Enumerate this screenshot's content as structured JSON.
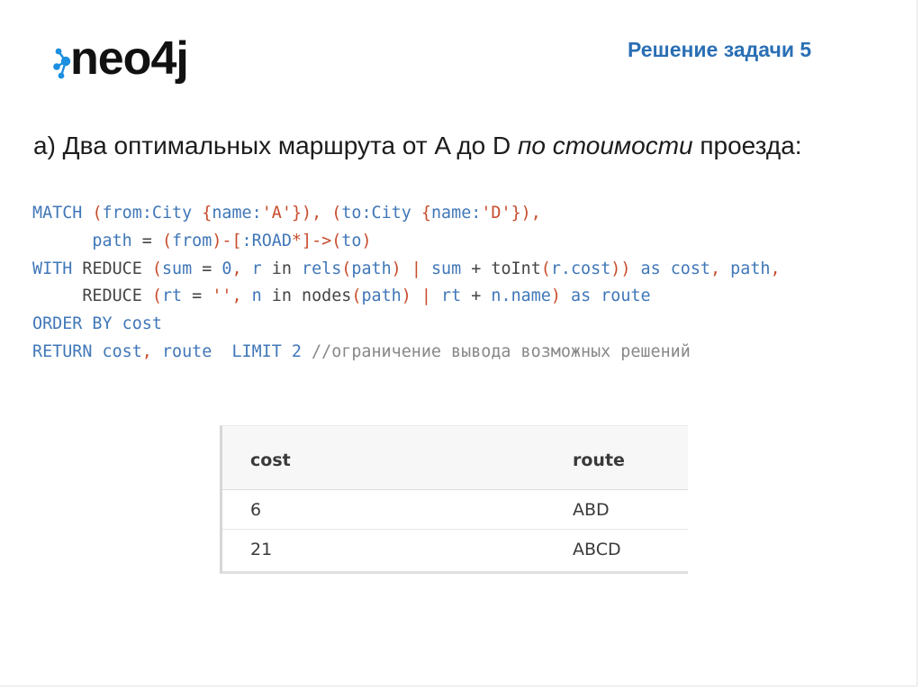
{
  "header": {
    "logo_text": "neo4j",
    "title": "Решение задачи 5"
  },
  "subtitle": {
    "prefix": "а) Два оптимальных маршрута от A до D ",
    "emphasis": "по стоимости",
    "suffix": " проезда:"
  },
  "code": {
    "lines": [
      [
        {
          "t": "MATCH",
          "c": "kw"
        },
        {
          "t": " (",
          "c": "pn"
        },
        {
          "t": "from:City",
          "c": "kw"
        },
        {
          "t": " {",
          "c": "pn"
        },
        {
          "t": "name:",
          "c": "kw"
        },
        {
          "t": "'A'",
          "c": "pn"
        },
        {
          "t": "}), (",
          "c": "pn"
        },
        {
          "t": "to:City",
          "c": "kw"
        },
        {
          "t": " {",
          "c": "pn"
        },
        {
          "t": "name:",
          "c": "kw"
        },
        {
          "t": "'D'",
          "c": "pn"
        },
        {
          "t": "}),",
          "c": "pn"
        }
      ],
      [
        {
          "t": "      path",
          "c": "kw"
        },
        {
          "t": " = ",
          "c": "df"
        },
        {
          "t": "(",
          "c": "pn"
        },
        {
          "t": "from",
          "c": "kw"
        },
        {
          "t": ")-[",
          "c": "pn"
        },
        {
          "t": ":ROAD",
          "c": "kw"
        },
        {
          "t": "*]->(",
          "c": "pn"
        },
        {
          "t": "to",
          "c": "kw"
        },
        {
          "t": ")",
          "c": "pn"
        }
      ],
      [
        {
          "t": "WITH",
          "c": "kw"
        },
        {
          "t": " REDUCE ",
          "c": "df"
        },
        {
          "t": "(",
          "c": "pn"
        },
        {
          "t": "sum",
          "c": "kw"
        },
        {
          "t": " = ",
          "c": "df"
        },
        {
          "t": "0",
          "c": "kw"
        },
        {
          "t": ", ",
          "c": "pn"
        },
        {
          "t": "r",
          "c": "kw"
        },
        {
          "t": " in ",
          "c": "df"
        },
        {
          "t": "rels",
          "c": "kw"
        },
        {
          "t": "(",
          "c": "pn"
        },
        {
          "t": "path",
          "c": "kw"
        },
        {
          "t": ") | ",
          "c": "pn"
        },
        {
          "t": "sum",
          "c": "kw"
        },
        {
          "t": " + toInt",
          "c": "df"
        },
        {
          "t": "(",
          "c": "pn"
        },
        {
          "t": "r.cost",
          "c": "kw"
        },
        {
          "t": ")) ",
          "c": "pn"
        },
        {
          "t": "as cost",
          "c": "kw"
        },
        {
          "t": ", ",
          "c": "pn"
        },
        {
          "t": "path",
          "c": "kw"
        },
        {
          "t": ",",
          "c": "pn"
        }
      ],
      [
        {
          "t": "     REDUCE ",
          "c": "df"
        },
        {
          "t": "(",
          "c": "pn"
        },
        {
          "t": "rt",
          "c": "kw"
        },
        {
          "t": " = ",
          "c": "df"
        },
        {
          "t": "''",
          "c": "pn"
        },
        {
          "t": ", ",
          "c": "pn"
        },
        {
          "t": "n",
          "c": "kw"
        },
        {
          "t": " in nodes",
          "c": "df"
        },
        {
          "t": "(",
          "c": "pn"
        },
        {
          "t": "path",
          "c": "kw"
        },
        {
          "t": ") | ",
          "c": "pn"
        },
        {
          "t": "rt",
          "c": "kw"
        },
        {
          "t": " + ",
          "c": "df"
        },
        {
          "t": "n.name",
          "c": "kw"
        },
        {
          "t": ") ",
          "c": "pn"
        },
        {
          "t": "as route",
          "c": "kw"
        }
      ],
      [
        {
          "t": "ORDER BY cost",
          "c": "kw"
        }
      ],
      [
        {
          "t": "RETURN cost",
          "c": "kw"
        },
        {
          "t": ", ",
          "c": "pn"
        },
        {
          "t": "route  LIMIT 2 ",
          "c": "kw"
        },
        {
          "t": "//ограничение вывода возможных решений",
          "c": "cm"
        }
      ]
    ]
  },
  "result_table": {
    "columns": [
      "cost",
      "route"
    ],
    "rows": [
      [
        "6",
        "ABD"
      ],
      [
        "21",
        "ABCD"
      ]
    ]
  }
}
